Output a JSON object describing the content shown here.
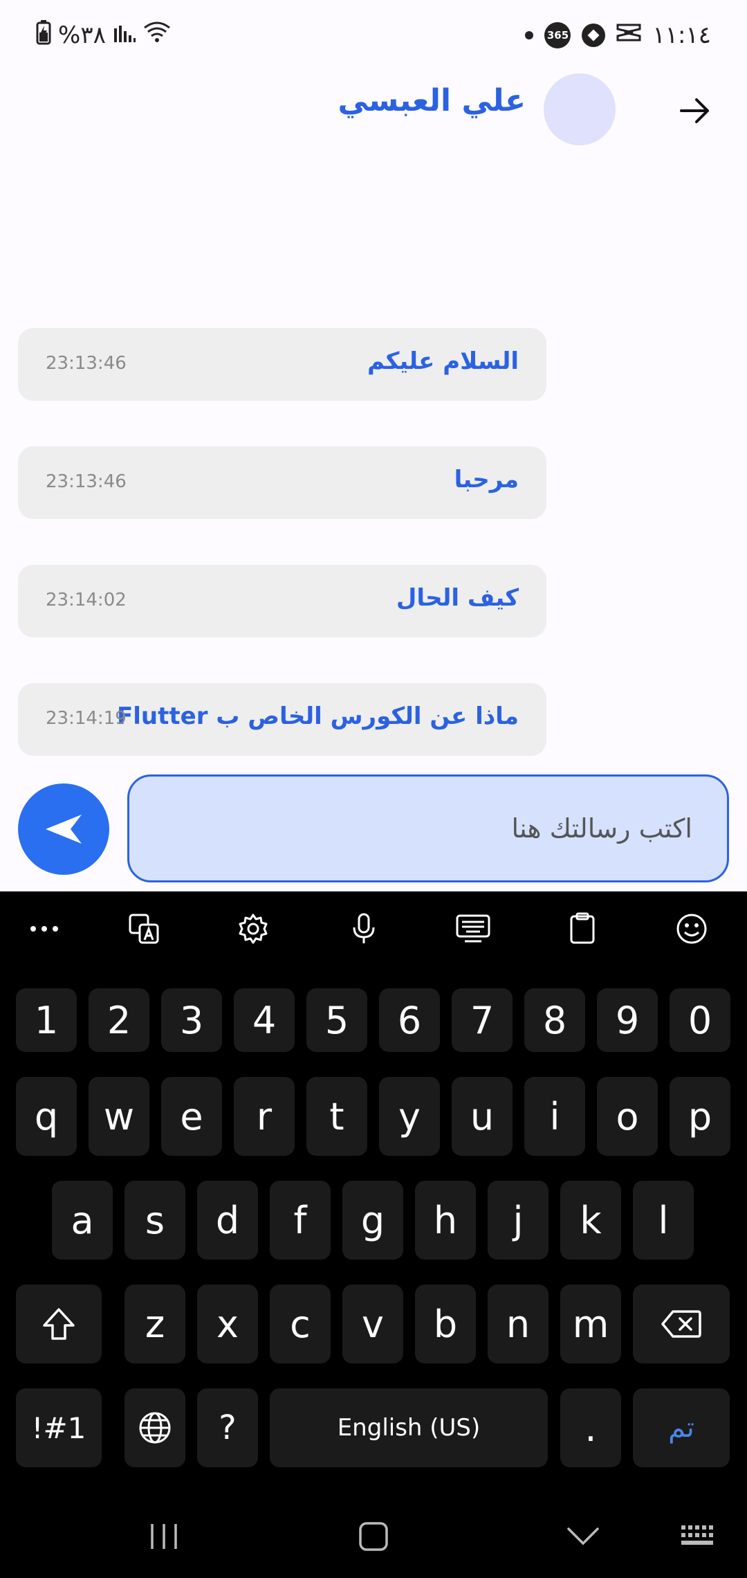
{
  "status_bar": {
    "time": "١١:١٤",
    "battery": "%٣٨"
  },
  "header": {
    "contact_name": "علي العبسي"
  },
  "messages": [
    {
      "text": "السلام عليكم",
      "time": "23:13:46"
    },
    {
      "text": "مرحبا",
      "time": "23:13:46"
    },
    {
      "text": "كيف الحال",
      "time": "23:14:02"
    },
    {
      "text": "ماذا عن الكورس الخاص ب Flutter",
      "time": "23:14:19"
    }
  ],
  "composer": {
    "placeholder": "اكتب رسالتك هنا"
  },
  "keyboard": {
    "row_numbers": [
      "1",
      "2",
      "3",
      "4",
      "5",
      "6",
      "7",
      "8",
      "9",
      "0"
    ],
    "row_1": [
      "q",
      "w",
      "e",
      "r",
      "t",
      "y",
      "u",
      "i",
      "o",
      "p"
    ],
    "row_2": [
      "a",
      "s",
      "d",
      "f",
      "g",
      "h",
      "j",
      "k",
      "l"
    ],
    "row_3": [
      "z",
      "x",
      "c",
      "v",
      "b",
      "n",
      "m"
    ],
    "symbols_label": "!#1",
    "question_label": "?",
    "space_label": "English (US)",
    "period_label": ".",
    "done_label": "تم"
  },
  "colors": {
    "accent": "#2b62e2",
    "send_button": "#2a6ff0",
    "input_bg": "#d6e1fd",
    "bubble_bg": "#eeeeee",
    "avatar_bg": "#dfe1fd"
  }
}
